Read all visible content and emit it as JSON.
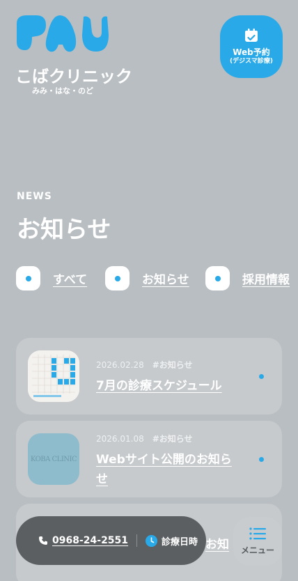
{
  "header": {
    "clinic_name": "こばクリニック",
    "clinic_sub": "みみ・はな・のど",
    "reserve_line1": "Web予約",
    "reserve_line2": "(デジスマ診療)"
  },
  "news": {
    "eyebrow": "NEWS",
    "title": "お知らせ",
    "filters": [
      {
        "label": "すべて"
      },
      {
        "label": "お知らせ"
      },
      {
        "label": "採用情報"
      }
    ],
    "items": [
      {
        "date": "2026.02.28",
        "tag": "#お知らせ",
        "title": "7月の診療スケジュール"
      },
      {
        "date": "2026.01.08",
        "tag": "#お知らせ",
        "title": "Webサイト公開のお知らせ"
      },
      {
        "date": "",
        "tag": "",
        "title": "お知"
      }
    ]
  },
  "contact": {
    "phone": "0968-24-2551",
    "hours_label": "診療日時"
  },
  "menu": {
    "label": "メニュー"
  },
  "thumb2_text": "KOBA CLINIC",
  "colors": {
    "accent": "#29a9e8",
    "overlay_bg": "#b9bec2",
    "card_bg": "#c6cacd",
    "contact_bar": "#5b5f61"
  }
}
